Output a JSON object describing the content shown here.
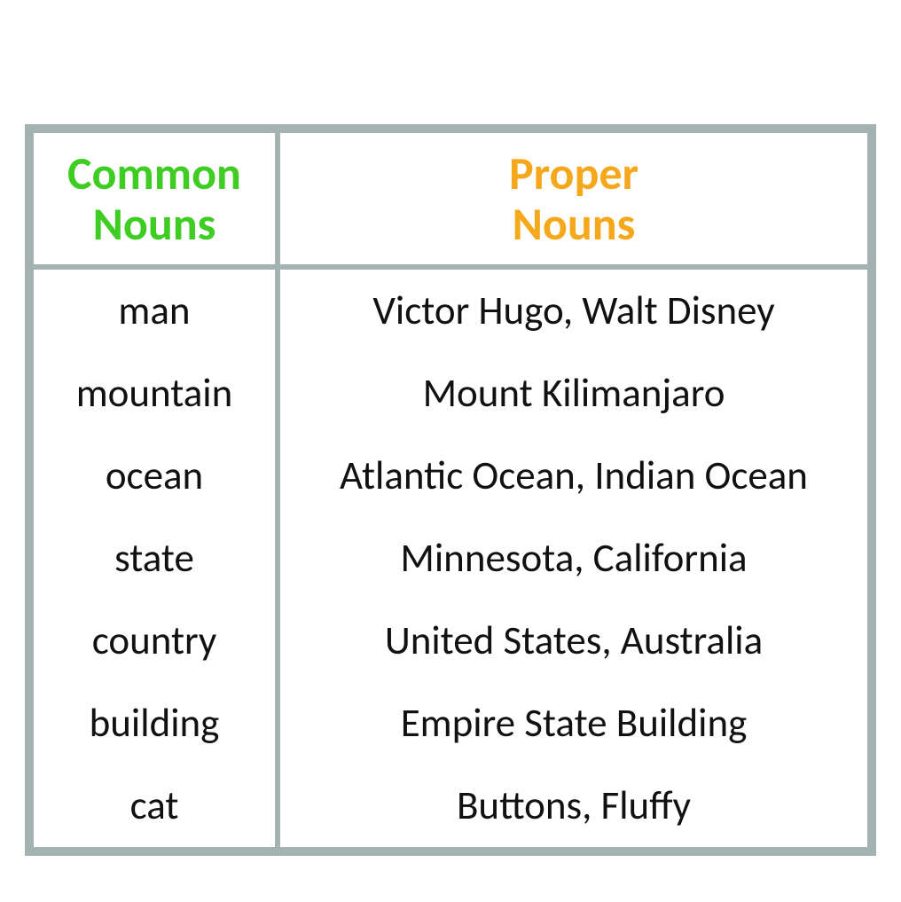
{
  "headers": {
    "common": "Common\nNouns",
    "proper": "Proper\nNouns"
  },
  "rows": [
    {
      "common": "man",
      "proper": "Victor Hugo,  Walt Disney"
    },
    {
      "common": "mountain",
      "proper": "Mount Kilimanjaro"
    },
    {
      "common": "ocean",
      "proper": "Atlantic Ocean, Indian Ocean"
    },
    {
      "common": "state",
      "proper": "Minnesota, California"
    },
    {
      "common": "country",
      "proper": "United States,  Australia"
    },
    {
      "common": "building",
      "proper": "Empire State Building"
    },
    {
      "common": "cat",
      "proper": "Buttons,  Fluffy"
    }
  ]
}
